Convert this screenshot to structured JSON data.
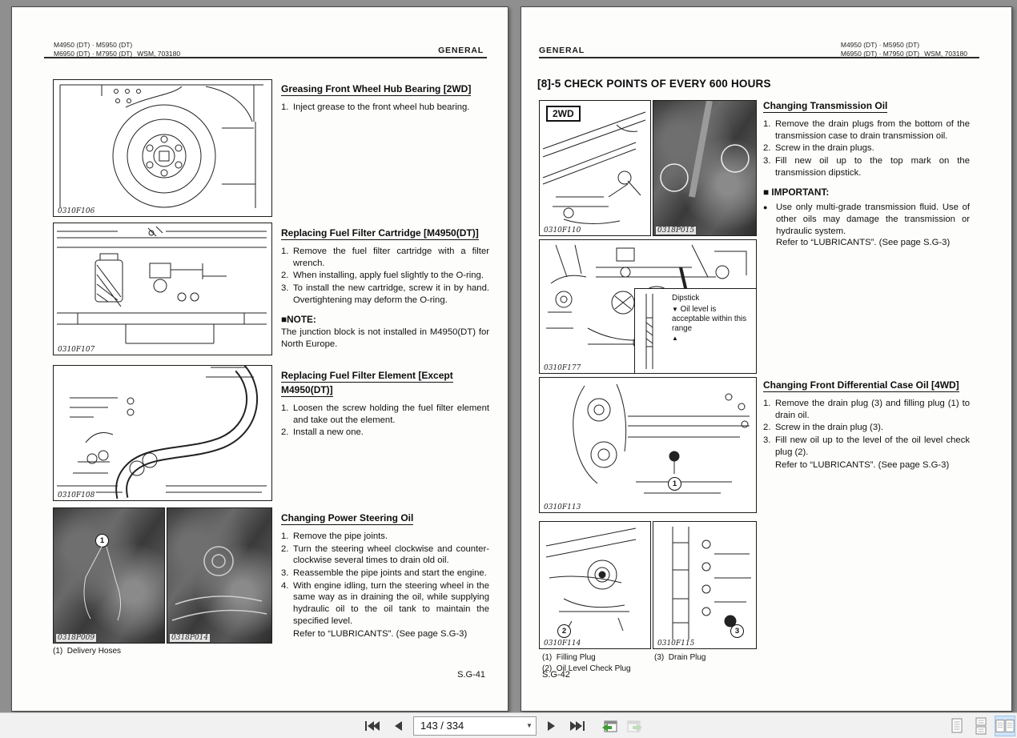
{
  "left_page": {
    "header": {
      "models_line1": "M4950 (DT) · M5950 (DT)",
      "models_line2": "M6950 (DT) · M7950 (DT)",
      "wsm": "WSM, 703180",
      "section": "GENERAL"
    },
    "sections": [
      {
        "title": "Greasing Front Wheel Hub Bearing [2WD]",
        "steps": [
          {
            "num": "1.",
            "text": "Inject grease to the front wheel hub bearing."
          }
        ]
      },
      {
        "title": "Replacing Fuel Filter Cartridge [M4950(DT)]",
        "steps": [
          {
            "num": "1.",
            "text": "Remove the fuel filter cartridge with a filter wrench."
          },
          {
            "num": "2.",
            "text": "When installing, apply fuel slightly to the O-ring."
          },
          {
            "num": "3.",
            "text": "To install the new cartridge, screw it in by hand. Overtightening may deform the O-ring."
          }
        ],
        "note_label": "■NOTE:",
        "note_text": "The junction block is not installed in M4950(DT) for North Europe."
      },
      {
        "title": "Replacing Fuel Filter Element [Except M4950(DT)]",
        "steps": [
          {
            "num": "1.",
            "text": "Loosen the screw holding the fuel filter element and take out the element."
          },
          {
            "num": "2.",
            "text": "Install a new one."
          }
        ]
      },
      {
        "title": "Changing Power Steering Oil",
        "steps": [
          {
            "num": "1.",
            "text": "Remove the pipe joints."
          },
          {
            "num": "2.",
            "text": "Turn the steering wheel clockwise and counter-clockwise several times to drain old oil."
          },
          {
            "num": "3.",
            "text": "Reassemble the pipe joints and start the engine."
          },
          {
            "num": "4.",
            "text": "With engine idling, turn the steering wheel in the same way as in draining the oil, while supplying hydraulic oil to the oil tank to maintain the specified level."
          }
        ],
        "refer": "Refer to “LUBRICANTS”. (See page S.G-3)"
      }
    ],
    "figures": {
      "f106": "0310F106",
      "f107": "0310F107",
      "f108": "0310F108",
      "p009": "0318P009",
      "p014": "0318P014"
    },
    "markers": {
      "p009": "1"
    },
    "captions": [
      {
        "num": "(1)",
        "text": "Delivery Hoses"
      }
    ],
    "page_number": "S.G-41"
  },
  "right_page": {
    "header": {
      "section": "GENERAL",
      "models_line1": "M4950 (DT) · M5950 (DT)",
      "models_line2": "M6950 (DT) · M7950 (DT)",
      "wsm": "WSM, 703180"
    },
    "title": "[8]-5 CHECK POINTS OF EVERY 600 HOURS",
    "sections": [
      {
        "title": "Changing Transmission Oil",
        "steps": [
          {
            "num": "1.",
            "text": "Remove the drain plugs from the bottom of the transmission case to drain transmission oil."
          },
          {
            "num": "2.",
            "text": "Screw in the drain plugs."
          },
          {
            "num": "3.",
            "text": "Fill new oil up to the top mark on the transmission dipstick."
          }
        ],
        "important_label": "■ IMPORTANT:",
        "important_bullet": "Use only multi-grade transmission fluid. Use of other oils may damage the transmission or hydraulic system.",
        "important_refer": "Refer to “LUBRICANTS”. (See page S.G-3)"
      },
      {
        "title": "Changing Front Differential Case Oil [4WD]",
        "steps": [
          {
            "num": "1.",
            "text": "Remove the drain plug (3) and filling plug (1) to drain oil."
          },
          {
            "num": "2.",
            "text": "Screw in the drain plug (3)."
          },
          {
            "num": "3.",
            "text": "Fill new oil up to the level of the oil level check plug (2)."
          }
        ],
        "refer": "Refer to “LUBRICANTS”. (See page S.G-3)"
      }
    ],
    "figures": {
      "f110": "0310F110",
      "f110_tag": "2WD",
      "p015": "0318P015",
      "f177": "0310F177",
      "f113": "0310F113",
      "f114": "0310F114",
      "f115": "0310F115"
    },
    "markers": {
      "f113": "1",
      "f114": "2",
      "f115": "3"
    },
    "inset": {
      "dipstick_label": "Dipstick",
      "arrow_down": "▼",
      "oil_level_text": "Oil level is acceptable within this range",
      "arrow_up": "▲"
    },
    "captions": [
      {
        "num": "(1)",
        "text": "Filling Plug"
      },
      {
        "num": "(2)",
        "text": "Oil Level Check Plug"
      },
      {
        "num": "(3)",
        "text": "Drain Plug"
      }
    ],
    "page_number": "S.G-42"
  },
  "toolbar": {
    "page_indicator": "143 / 334",
    "caret": "▼",
    "icons": {
      "first_page": "first-page-icon",
      "previous_page": "previous-page-icon",
      "next_page": "next-page-icon",
      "last_page": "last-page-icon",
      "previous_view": "previous-view-icon",
      "next_view": "next-view-icon",
      "single_page_layout": "single-page-layout-icon",
      "continuous_layout": "continuous-scroll-layout-icon",
      "two_page_layout": "two-page-layout-icon"
    },
    "selected_layout": "two-page",
    "accent_green": "#3f9c35",
    "selection_blue": "#cfe4f7"
  }
}
